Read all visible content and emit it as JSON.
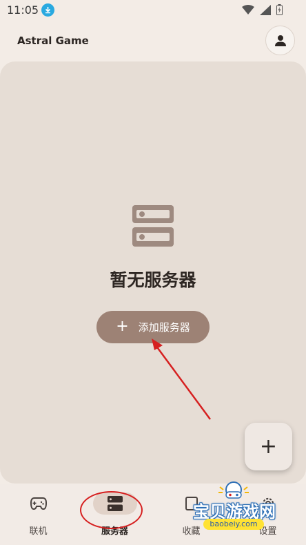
{
  "status_bar": {
    "time": "11:05",
    "download_icon": "download-arrow-icon",
    "wifi_icon": "wifi-icon",
    "signal_icon": "signal-icon",
    "battery_icon": "battery-icon"
  },
  "app_bar": {
    "title": "Astral Game",
    "account_icon": "person-icon"
  },
  "empty_state": {
    "icon": "server-icon",
    "title": "暂无服务器",
    "add_button_label": "添加服务器"
  },
  "fab": {
    "icon": "plus-icon",
    "label": "+"
  },
  "bottom_nav": {
    "items": [
      {
        "label": "联机",
        "icon": "gamepad-icon",
        "active": false
      },
      {
        "label": "服务器",
        "icon": "server-icon",
        "active": true
      },
      {
        "label": "收藏",
        "icon": "bookmark-icon",
        "active": false
      },
      {
        "label": "设置",
        "icon": "settings-icon",
        "active": false
      }
    ]
  },
  "watermark": {
    "text": "宝贝游戏网",
    "url": "baobeiy.com"
  },
  "colors": {
    "background": "#f3ece6",
    "card": "#e6ddd5",
    "button": "#9d8275",
    "annotation": "#d62020"
  }
}
